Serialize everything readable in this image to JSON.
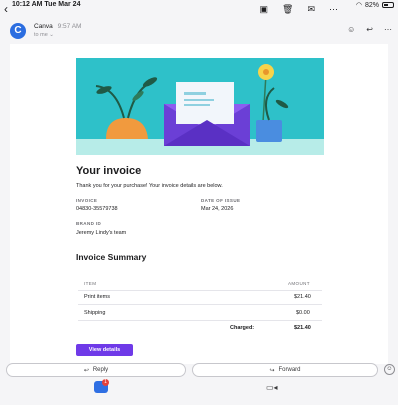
{
  "status_bar": {
    "time": "10:12 AM  Tue Mar 24",
    "battery": "82%"
  },
  "mail": {
    "sender": "Canva",
    "time": "9:57 AM",
    "recipient": "to me ⌄",
    "avatar_letter": "C"
  },
  "email": {
    "title": "Your invoice",
    "intro": "Thank you for your purchase! Your invoice details are below.",
    "invoice_label": "INVOICE",
    "invoice_value": "04830-35579738",
    "date_label": "DATE OF ISSUE",
    "date_value": "Mar 24, 2026",
    "brand_label": "BRAND ID",
    "brand_value": "Jeremy Lindy's team",
    "summary_title": "Invoice Summary",
    "table": {
      "col_item": "ITEM",
      "col_amount": "AMOUNT",
      "rows": [
        {
          "item": "Print items",
          "amount": "$21.40"
        },
        {
          "item": "Shipping",
          "amount": "$0.00"
        }
      ],
      "charged_label": "Charged:",
      "charged_value": "$21.40"
    },
    "details_button": "View details"
  },
  "reply_bar": {
    "reply": "Reply",
    "forward": "Forward"
  },
  "colors": {
    "accent": "#6f3ae8",
    "hero": "#2ec1c9",
    "avatar": "#2b6de0"
  }
}
